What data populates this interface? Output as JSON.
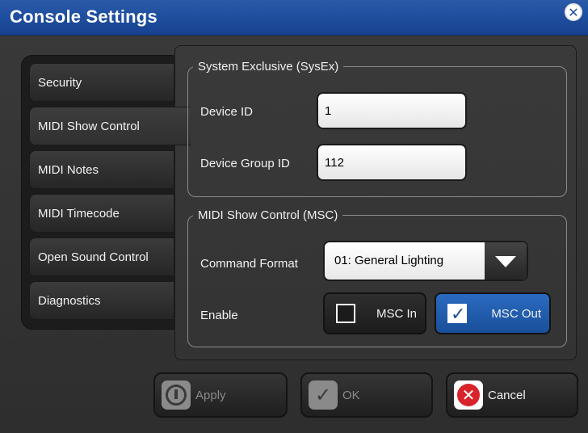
{
  "window": {
    "title": "Console Settings",
    "close_icon": "close-icon"
  },
  "tabs": [
    {
      "label": "Security"
    },
    {
      "label": "MIDI Show Control",
      "active": true
    },
    {
      "label": "MIDI Notes"
    },
    {
      "label": "MIDI Timecode"
    },
    {
      "label": "Open Sound Control"
    },
    {
      "label": "Diagnostics"
    }
  ],
  "sysex": {
    "group_title": "System Exclusive (SysEx)",
    "device_id_label": "Device ID",
    "device_id_value": "1",
    "device_group_label": "Device Group ID",
    "device_group_value": "112"
  },
  "msc": {
    "group_title": "MIDI Show Control (MSC)",
    "command_format_label": "Command Format",
    "command_format_value": "01: General Lighting",
    "enable_label": "Enable",
    "msc_in": {
      "label": "MSC In",
      "checked": false
    },
    "msc_out": {
      "label": "MSC Out",
      "checked": true
    }
  },
  "buttons": {
    "apply": {
      "label": "Apply",
      "enabled": false
    },
    "ok": {
      "label": "OK",
      "enabled": false
    },
    "cancel": {
      "label": "Cancel",
      "enabled": true
    }
  },
  "colors": {
    "titlebar": "#1f4f9f",
    "active_toggle": "#2a6ac0",
    "cancel_red": "#d8232a"
  }
}
